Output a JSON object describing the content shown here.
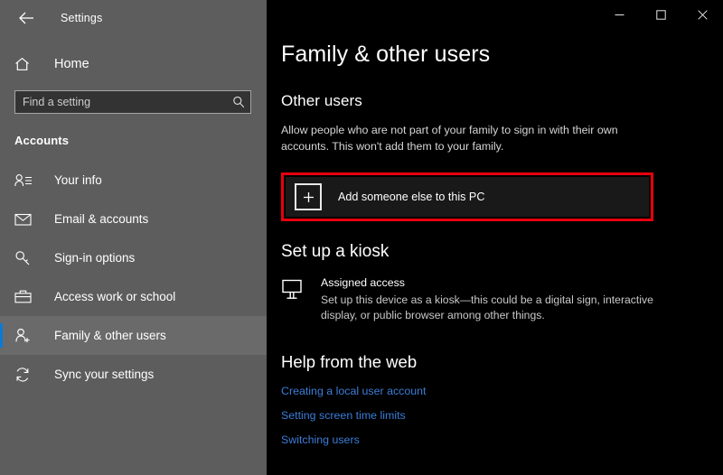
{
  "window": {
    "title": "Settings",
    "back_icon": "back-arrow-icon",
    "controls": {
      "minimize": "–",
      "maximize": "□",
      "close": "✕"
    }
  },
  "sidebar": {
    "home_label": "Home",
    "home_icon": "home-icon",
    "search": {
      "placeholder": "Find a setting",
      "value": "",
      "icon": "search-icon"
    },
    "category": "Accounts",
    "items": [
      {
        "label": "Your info",
        "icon": "person-info-icon",
        "selected": false
      },
      {
        "label": "Email & accounts",
        "icon": "envelope-icon",
        "selected": false
      },
      {
        "label": "Sign-in options",
        "icon": "key-icon",
        "selected": false
      },
      {
        "label": "Access work or school",
        "icon": "briefcase-icon",
        "selected": false
      },
      {
        "label": "Family & other users",
        "icon": "person-add-icon",
        "selected": true
      },
      {
        "label": "Sync your settings",
        "icon": "sync-icon",
        "selected": false
      }
    ]
  },
  "main": {
    "page_title": "Family & other users",
    "other_users": {
      "heading": "Other users",
      "description": "Allow people who are not part of your family to sign in with their own accounts. This won't add them to your family.",
      "add_button_label": "Add someone else to this PC",
      "add_button_icon": "plus-square-icon"
    },
    "kiosk": {
      "heading": "Set up a kiosk",
      "icon": "monitor-icon",
      "title": "Assigned access",
      "description": "Set up this device as a kiosk—this could be a digital sign, interactive display, or public browser among other things."
    },
    "help": {
      "heading": "Help from the web",
      "links": [
        "Creating a local user account",
        "Setting screen time limits",
        "Switching users"
      ]
    }
  },
  "annotation": {
    "highlight_color": "#e8000d"
  },
  "colors": {
    "accent": "#0a7ad4",
    "sidebar_bg": "#5d5d5d",
    "main_bg": "#000000",
    "link": "#3b7dd8"
  }
}
